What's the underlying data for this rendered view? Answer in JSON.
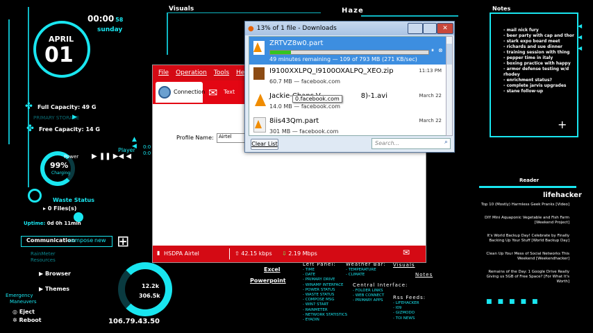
{
  "clock": {
    "time": "00:00",
    "seconds": "58",
    "day": "sunday",
    "month": "APRIL",
    "date": "01"
  },
  "storage": {
    "full_capacity_label": "Full Capacity:",
    "full_capacity_value": "49 G",
    "primary_label": "PRIMARY STORAGE",
    "free_label": "Free Capacity:",
    "free_value": "14 G"
  },
  "power": {
    "label": "Power",
    "percent": "99%",
    "state": "Charging"
  },
  "player": {
    "label": "Player",
    "t1": "0:0",
    "t2": "0:0"
  },
  "waste": {
    "label": "Waste Status",
    "files": "0 Files(s)"
  },
  "uptime": {
    "label": "Uptime:",
    "value": "0d 0h 11min"
  },
  "communication": {
    "label": "Communication",
    "compose": "compose",
    "new": "new"
  },
  "rainmeter": {
    "line1": "RainMeter",
    "line2": "Resources"
  },
  "leftlinks": {
    "browser": "Browser",
    "themes": "Themes"
  },
  "emergency": {
    "title": "Emergency",
    "subtitle": "Maneuvers",
    "eject": "Eject",
    "reboot": "Reboot"
  },
  "network": {
    "up": "12.2k",
    "down": "306.5k",
    "ip": "106.79.43.50"
  },
  "top_labels": {
    "visuals": "Visuals",
    "haze": "Haze",
    "notes": "Notes"
  },
  "notes": [
    "- mail nick fury",
    "- beer party with cap and thor",
    "- stark expo board meet",
    "- richards and sue dinner",
    "- training session with thing",
    "- pepper time in italy",
    "- boxing practice with happy",
    "- armor defense testing w/d rhodey",
    "- enrichment status?",
    "- complete jarvis upgrades",
    "- stane follow-up"
  ],
  "reader": {
    "title": "Reader",
    "source": "lifehacker",
    "items": [
      "Top 10 (Mostly) Harmless Geek Pranks [Video]",
      "DIY Mini Aquaponic Vegetable and Fish Farm [Weekend Project]",
      "It's World Backup Day! Celebrate by Finally Backing Up Your Stuff [World Backup Day]",
      "Clean Up Your Mess of Social Networks This Weekend [Weekendhacker]",
      "Remains of the Day: 1 Google Drive Really Giving us 5GB of Free Space? [For What It's Worth]"
    ]
  },
  "bottom_panels": {
    "left_panel": {
      "title": "Left Panel:",
      "items": [
        "- TIME",
        "- DATE",
        "- PRIMARY DRIVE",
        "- WINAMP INTERFACE",
        "- POWER STATUS",
        "- WASTE STATUS",
        "- COMPOSE MSG",
        "- WIN7 START",
        "- RAINMETER",
        "- NETWORK STATISTICS",
        "- EYADIN"
      ]
    },
    "weather": {
      "title": "Weather Bar:",
      "items": [
        "- TEMPERATURE",
        "- CLIMATE"
      ]
    },
    "central": {
      "title": "Central Interface:",
      "items": [
        "- FOLDER LINKS",
        "- WEB CONNECT",
        "- PRIMARY APPS"
      ]
    },
    "visuals": {
      "title": "Visuals",
      "notes": "Notes",
      "rss_title": "Rss Feeds:",
      "rss_items": [
        "- LIFEHACKER",
        "- I09",
        "- GIZMODO",
        "- TOI NEWS"
      ]
    },
    "apps": [
      "Excel",
      "Powerpoint"
    ]
  },
  "downloads": {
    "title": "13% of 1 file - Downloads",
    "items": [
      {
        "name": "ZRTVZ8w0.part",
        "sub": "49 minutes remaining — 109 of 793 MB (271 KB/sec)",
        "date": "",
        "progress": 0.13
      },
      {
        "name": "I9100XXLPQ_I9100OXALPQ_XEO.zip",
        "sub": "60.7 MB — facebook.com",
        "date": "11:13 PM"
      },
      {
        "name": "Jackie-Chans-V",
        "name_tail": "8)-1.avi",
        "sub": "14.0 MB — facebook.com",
        "date": "March 22"
      },
      {
        "name": "8iis43Qm.part",
        "sub": "301 MB — facebook.com",
        "date": "March 22"
      }
    ],
    "tooltip": "0.facebook.com",
    "clear_button": "Clear List",
    "search_placeholder": "Search..."
  },
  "connection_manager": {
    "menu": [
      "File",
      "Operation",
      "Tools",
      "Help"
    ],
    "tabs": [
      "Connection",
      "Text"
    ],
    "profile_label": "Profile Name:",
    "profile_value": "Airtel",
    "status": {
      "network": "HSDPA",
      "carrier": "Airtel",
      "up": "42.15 kbps",
      "down": "2.19 Mbps"
    }
  }
}
